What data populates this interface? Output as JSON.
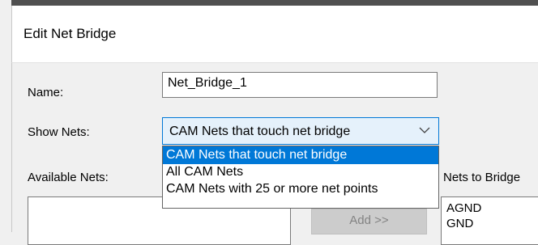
{
  "dialog": {
    "title": "Edit Net Bridge"
  },
  "name_field": {
    "label": "Name:",
    "value": "Net_Bridge_1"
  },
  "show_nets": {
    "label": "Show Nets:",
    "selected": "CAM Nets that touch net bridge",
    "options": [
      "CAM Nets that touch net bridge",
      "All CAM Nets",
      "CAM Nets with 25 or more net points"
    ]
  },
  "available_nets": {
    "label": "Available Nets:"
  },
  "add_button": {
    "label": "Add >>"
  },
  "nets_to_bridge": {
    "label": "Nets to Bridge",
    "items": [
      "AGND",
      "GND"
    ]
  },
  "colors": {
    "accent": "#0078d7",
    "combo_bg": "#e5f1fb",
    "disabled_button": "#cccccc"
  }
}
